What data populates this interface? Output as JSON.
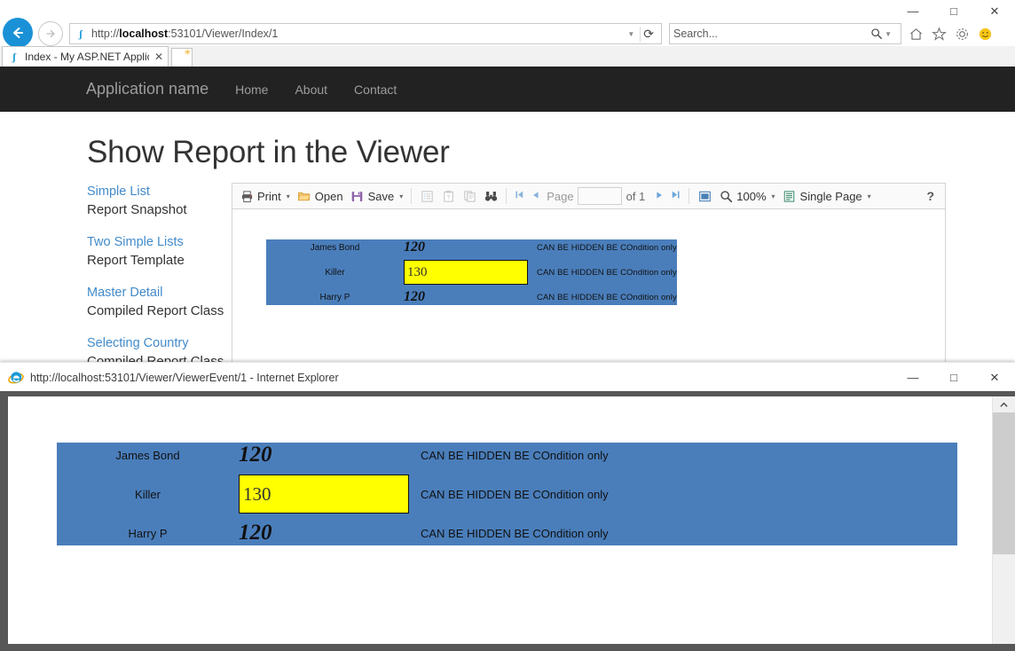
{
  "browser": {
    "window_controls": {
      "minimize": "—",
      "maximize": "□",
      "close": "✕"
    },
    "back_icon": "←",
    "forward_icon": "⇒",
    "address": {
      "url_prefix": "http://",
      "url_host": "localhost",
      "url_rest": ":53101/Viewer/Index/1",
      "dropdown_icon": "▼",
      "refresh_icon": "⟳"
    },
    "search": {
      "placeholder": "Search...",
      "magnifier_icon": "⚲",
      "dropdown_icon": "▼"
    },
    "command_icons": [
      "home-icon",
      "favorites-icon",
      "tools-icon",
      "smiley-icon"
    ],
    "tab": {
      "title": "Index - My ASP.NET Applic...",
      "close_icon": "✕",
      "favicon_letter": "ʃ"
    },
    "new_tab_tooltip": "New tab"
  },
  "site": {
    "navbar": {
      "brand": "Application name",
      "links": [
        "Home",
        "About",
        "Contact"
      ]
    },
    "page_title": "Show Report in the Viewer"
  },
  "sidebar": {
    "groups": [
      {
        "link": "Simple List",
        "sub": "Report Snapshot"
      },
      {
        "link": "Two Simple Lists",
        "sub": "Report Template"
      },
      {
        "link": "Master Detail",
        "sub": "Compiled Report Class"
      },
      {
        "link": "Selecting Country",
        "sub": "Compiled Report Class"
      }
    ]
  },
  "viewer_toolbar": {
    "print_label": "Print",
    "open_label": "Open",
    "save_label": "Save",
    "dropdown_caret": "▾",
    "disabled_icons": [
      "document-map-icon",
      "parameters-icon",
      "refresh-icon"
    ],
    "find_icon": "find-binoculars-icon",
    "first_page_icon": "⏮",
    "prev_page_icon": "◀",
    "page_label": "Page",
    "page_value": "",
    "of_label": "of 1",
    "next_page_icon": "▶",
    "last_page_icon": "⏭",
    "page_view_icon": "page-view-icon",
    "zoom_label": "100%",
    "view_mode_label": "Single Page",
    "help_label": "?"
  },
  "report": {
    "background_color": "#4a7ebb",
    "highlight_color": "#ffff00",
    "rows": [
      {
        "name": "James Bond",
        "value": "120",
        "highlighted": false,
        "note": "CAN BE HIDDEN BE COndition only"
      },
      {
        "name": "Killer",
        "value": "130",
        "highlighted": true,
        "note": "CAN BE HIDDEN BE COndition only"
      },
      {
        "name": "Harry P",
        "value": "120",
        "highlighted": false,
        "note": "CAN BE HIDDEN BE COndition only"
      }
    ]
  },
  "popup": {
    "title": "http://localhost:53101/Viewer/ViewerEvent/1 - Internet Explorer",
    "favicon": "internet-explorer-icon",
    "window_controls": {
      "minimize": "—",
      "maximize": "□",
      "close": "✕"
    },
    "scroll_up_icon": "▲",
    "report": {
      "rows": [
        {
          "name": "James Bond",
          "value": "120",
          "highlighted": false,
          "note": "CAN BE HIDDEN BE COndition only"
        },
        {
          "name": "Killer",
          "value": "130",
          "highlighted": true,
          "note": "CAN BE HIDDEN BE COndition only"
        },
        {
          "name": "Harry P",
          "value": "120",
          "highlighted": false,
          "note": "CAN BE HIDDEN BE COndition only"
        }
      ]
    }
  }
}
